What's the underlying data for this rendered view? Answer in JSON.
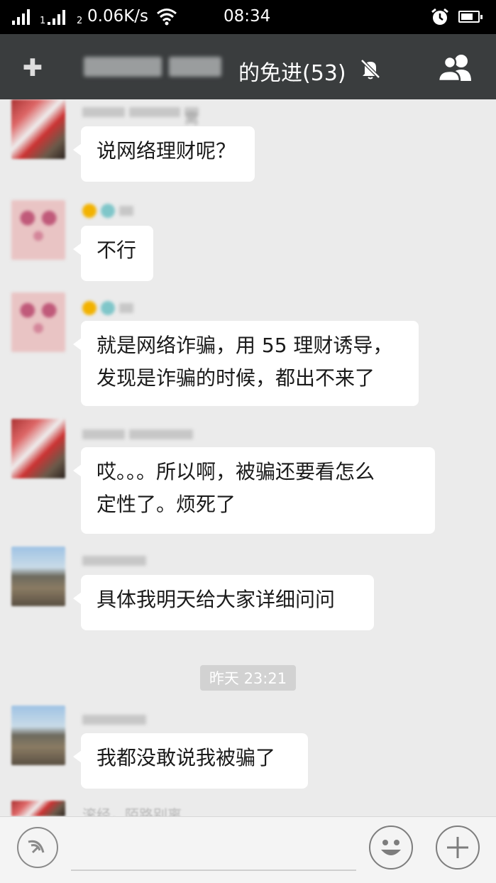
{
  "status_bar": {
    "sim1": "1",
    "sim2": "2",
    "net_speed": "0.06K/s",
    "time": "08:34"
  },
  "header": {
    "group_title_visible": "的免进(53)",
    "back_icon": "plus-icon",
    "mute_icon": "bell-off-icon",
    "members_icon": "group-members-icon"
  },
  "messages": [
    {
      "name_tail": "离",
      "text_lines": [
        "说网络理财呢？"
      ]
    },
    {
      "name_tail": "",
      "text_lines": [
        "不行"
      ]
    },
    {
      "name_tail": "",
      "text_lines": [
        "就是网络诈骗，用 55 理财诱导，",
        "发现是诈骗的时候，都出不来了"
      ]
    },
    {
      "name_tail": "",
      "text_lines": [
        "哎。。。所以啊，被骗还要看怎么",
        "定性了。烦死了"
      ]
    },
    {
      "name_tail": "",
      "text_lines": [
        "具体我明天给大家详细问问"
      ]
    },
    {
      "name_tail": "",
      "text_lines": [
        "我都没敢说我被骗了"
      ]
    }
  ],
  "timestamp": "昨天 23:21",
  "partial_name": "滚经，陌路别离",
  "input_bar": {
    "voice_icon": "voice-icon",
    "emoji_icon": "emoji-icon",
    "more_icon": "plus-icon"
  }
}
